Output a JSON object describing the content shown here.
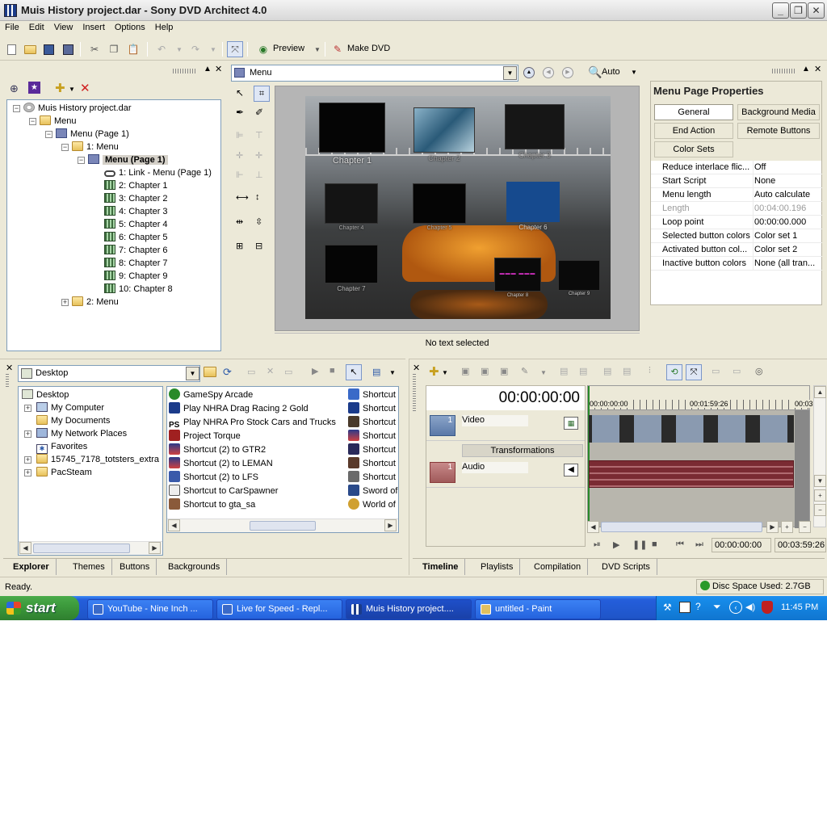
{
  "window": {
    "title": "Muis History project.dar - Sony DVD Architect 4.0",
    "minimize": "_",
    "maximize": "❐",
    "close": "✕"
  },
  "menubar": {
    "items": [
      "File",
      "Edit",
      "View",
      "Insert",
      "Options",
      "Help"
    ]
  },
  "toolbar": {
    "preview_label": "Preview",
    "make_dvd_label": "Make DVD"
  },
  "project_tree": {
    "root": "Muis History project.dar",
    "menu": "Menu",
    "menu_page": "Menu (Page 1)",
    "menu1": "1: Menu",
    "menu1_page": "Menu (Page 1)",
    "items": [
      "1: Link - Menu (Page 1)",
      "2: Chapter 1",
      "3: Chapter 2",
      "4: Chapter 3",
      "5: Chapter 4",
      "6: Chapter 5",
      "7: Chapter 6",
      "8: Chapter 7",
      "9: Chapter 9",
      "10: Chapter 8"
    ],
    "menu2": "2: Menu"
  },
  "workspace": {
    "dropdown_value": "Menu",
    "zoom_value": "Auto",
    "status_text": "No text selected",
    "chapters": [
      {
        "label": "Chapter 1"
      },
      {
        "label": "Chapter 2"
      },
      {
        "label": "Chapter 3"
      },
      {
        "label": "Chapter 4"
      },
      {
        "label": "Chapter 5"
      },
      {
        "label": "Chapter 6"
      },
      {
        "label": "Chapter 7"
      },
      {
        "label": "Chapter 8"
      },
      {
        "label": "Chapter 9"
      }
    ]
  },
  "properties": {
    "title": "Menu Page Properties",
    "tabs": [
      "General",
      "Background Media",
      "End Action",
      "Remote Buttons",
      "Color Sets"
    ],
    "rows": [
      {
        "key": "Reduce interlace flic...",
        "value": "Off"
      },
      {
        "key": "Start Script",
        "value": "None"
      },
      {
        "key": "Menu length",
        "value": "Auto calculate"
      },
      {
        "key": "Length",
        "value": "00:04:00.196"
      },
      {
        "key": "Loop point",
        "value": "00:00:00.000"
      },
      {
        "key": "Selected button colors",
        "value": "Color set 1"
      },
      {
        "key": "Activated button col...",
        "value": "Color set 2"
      },
      {
        "key": "Inactive button colors",
        "value": "None (all tran..."
      }
    ]
  },
  "explorer": {
    "location": "Desktop",
    "tree": [
      "Desktop",
      "My Computer",
      "My Documents",
      "My Network Places",
      "Favorites",
      "15745_7178_totsters_extra",
      "PacSteam"
    ],
    "files": [
      "GameSpy Arcade",
      "Play NHRA Drag Racing 2 Gold",
      "Play NHRA Pro Stock Cars and Trucks",
      "Project Torque",
      "Shortcut (2) to GTR2",
      "Shortcut (2) to LEMAN",
      "Shortcut (2) to LFS",
      "Shortcut to CarSpawner",
      "Shortcut to gta_sa"
    ],
    "files_col2": [
      "Shortcut",
      "Shortcut",
      "Shortcut",
      "Shortcut",
      "Shortcut",
      "Shortcut",
      "Shortcut",
      "Sword of",
      "World of"
    ],
    "tabs": [
      "Explorer",
      "Themes",
      "Buttons",
      "Backgrounds"
    ]
  },
  "timeline": {
    "timecode": "00:00:00:00",
    "ruler": [
      "00:00:00:00",
      "00:01:59:26",
      "00:03"
    ],
    "video_track": "Video",
    "video_num": "1",
    "transformations": "Transformations",
    "audio_track": "Audio",
    "audio_num": "1",
    "pos_time": "00:00:00:00",
    "end_time": "00:03:59:26",
    "tabs": [
      "Timeline",
      "Playlists",
      "Compilation",
      "DVD Scripts"
    ]
  },
  "statusbar": {
    "ready": "Ready.",
    "disc_space": "Disc Space Used: 2.7GB"
  },
  "taskbar": {
    "start": "start",
    "tasks": [
      "YouTube - Nine Inch ...",
      "Live for Speed - Repl...",
      "Muis History project....",
      "untitled - Paint"
    ],
    "clock": "11:45 PM"
  },
  "colors": {
    "accent": "#316ac5",
    "taskbar": "#245edb",
    "start": "#3c9a3c",
    "audio_wave": "#7a2b33"
  }
}
